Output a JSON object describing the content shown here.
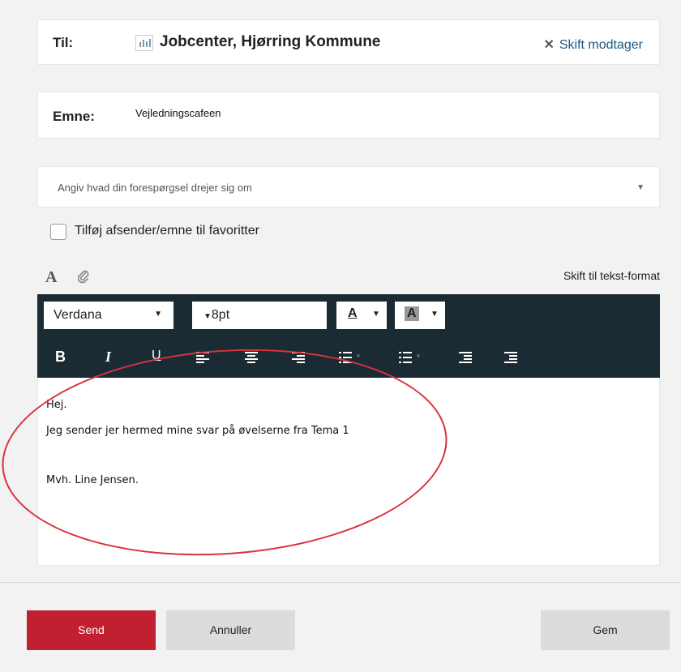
{
  "to": {
    "label": "Til:",
    "recipient": "Jobcenter, Hjørring Kommune",
    "change_label": "Skift modtager"
  },
  "subject": {
    "label": "Emne:",
    "value": "Vejledningscafeen"
  },
  "topic_select": {
    "placeholder": "Angiv hvad din forespørgsel drejer sig om"
  },
  "favorite": {
    "label": "Tilføj afsender/emne til favoritter",
    "checked": false
  },
  "editor_header": {
    "switch_label": "Skift til tekst-format"
  },
  "toolbar": {
    "font": "Verdana",
    "size": "8pt",
    "text_color_label": "A",
    "bg_color_label": "A",
    "bold": "B",
    "italic": "I",
    "underline": "U"
  },
  "message": {
    "line1": "Hej.",
    "line2": "Jeg sender jer hermed mine svar på øvelserne fra Tema 1",
    "line3": "Mvh. Line Jensen."
  },
  "actions": {
    "send": "Send",
    "cancel": "Annuller",
    "save": "Gem"
  },
  "colors": {
    "primary": "#c0202f",
    "toolbar_bg": "#1a2b33",
    "link": "#1b5a84",
    "annotation": "#d8323c"
  }
}
